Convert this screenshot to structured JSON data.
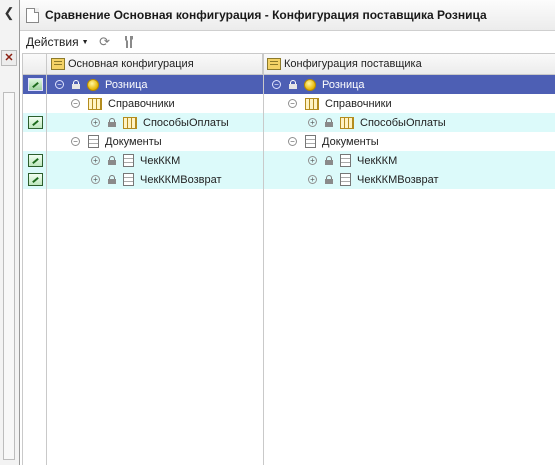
{
  "window": {
    "title": "Сравнение Основная конфигурация - Конфигурация поставщика Розница"
  },
  "toolbar": {
    "actions_label": "Действия",
    "icons": [
      "refresh-icon",
      "settings-icon"
    ]
  },
  "columns": {
    "left_header": "Основная конфигурация",
    "right_header": "Конфигурация поставщика"
  },
  "rows": [
    {
      "left": "Розница",
      "right": "Розница",
      "icon": "configuration-icon",
      "selected": true,
      "changed": true
    },
    {
      "left": "Справочники",
      "right": "Справочники",
      "icon": "catalogs-icon",
      "selected": false,
      "changed": false
    },
    {
      "left": "СпособыОплаты",
      "right": "СпособыОплаты",
      "icon": "catalog-icon",
      "selected": false,
      "changed": true
    },
    {
      "left": "Документы",
      "right": "Документы",
      "icon": "documents-icon",
      "selected": false,
      "changed": false
    },
    {
      "left": "ЧекККМ",
      "right": "ЧекККМ",
      "icon": "document-icon",
      "selected": false,
      "changed": true
    },
    {
      "left": "ЧекККМВозврат",
      "right": "ЧекККМВозврат",
      "icon": "document-icon",
      "selected": false,
      "changed": true
    }
  ]
}
